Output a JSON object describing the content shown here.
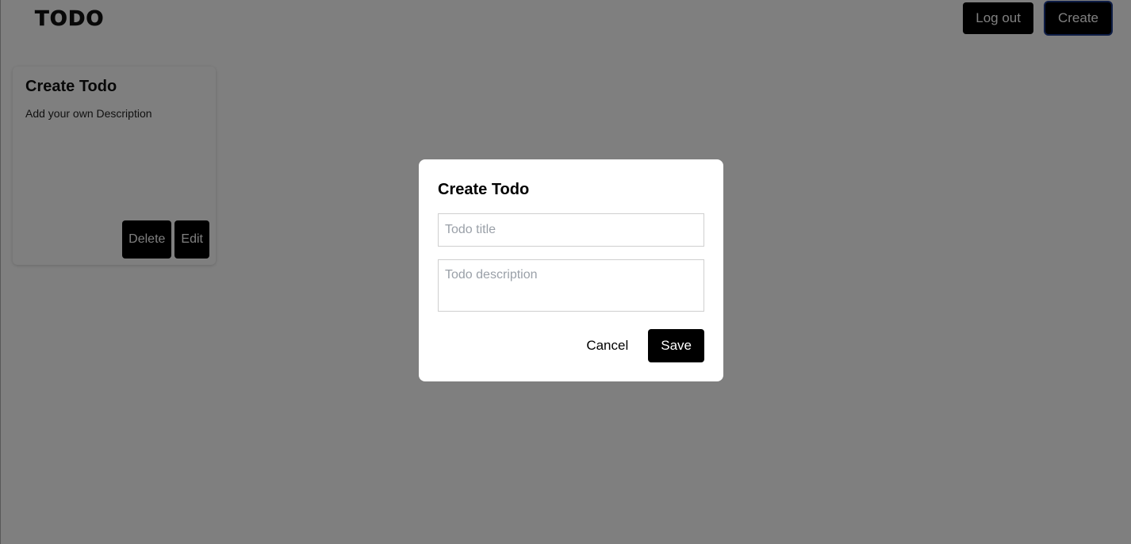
{
  "header": {
    "logo_text": "TODO",
    "logout_label": "Log out",
    "create_label": "Create"
  },
  "todos": [
    {
      "title": "Create Todo",
      "description": "Add your own Description",
      "delete_label": "Delete",
      "edit_label": "Edit"
    }
  ],
  "modal": {
    "title": "Create Todo",
    "title_placeholder": "Todo title",
    "title_value": "",
    "description_placeholder": "Todo description",
    "description_value": "",
    "cancel_label": "Cancel",
    "save_label": "Save"
  },
  "colors": {
    "primary_button": "#000000",
    "overlay": "rgba(0,0,0,0.5)",
    "active_outline": "#1d3a8a"
  }
}
